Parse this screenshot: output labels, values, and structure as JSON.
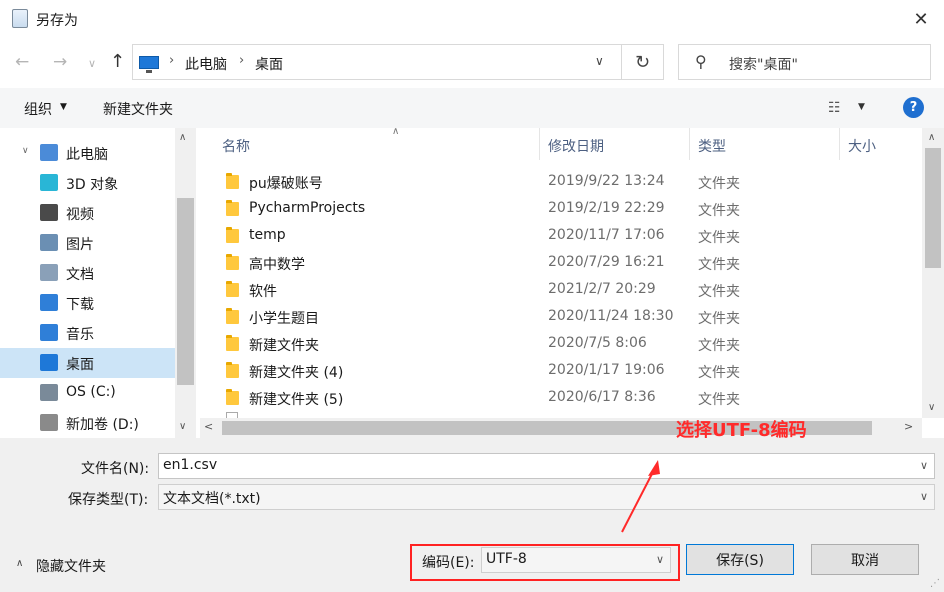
{
  "window": {
    "title": "另存为",
    "close_symbol": "✕"
  },
  "nav": {
    "back_symbol": "←",
    "forward_symbol": "→",
    "recent_symbol": "∨",
    "up_symbol": "↑",
    "breadcrumbs": [
      "此电脑",
      "桌面"
    ],
    "separator": "›",
    "dropdown_symbol": "∨",
    "refresh_symbol": "↻",
    "search_placeholder": "搜索\"桌面\"",
    "search_symbol": "⚲"
  },
  "toolbar": {
    "organize_label": "组织",
    "caret": "▼",
    "new_folder_label": "新建文件夹",
    "view_symbol": "☷",
    "help_symbol": "?"
  },
  "sidebar": {
    "items": [
      {
        "label": "此电脑",
        "icon": "pc-icon",
        "color": "#4b8bd8",
        "expand": "∨",
        "selected": false
      },
      {
        "label": "3D 对象",
        "icon": "cube-icon",
        "color": "#29b6d6",
        "expand": "",
        "selected": false
      },
      {
        "label": "视频",
        "icon": "video-icon",
        "color": "#4a4a4a",
        "expand": "",
        "selected": false
      },
      {
        "label": "图片",
        "icon": "picture-icon",
        "color": "#6b8fb3",
        "expand": "",
        "selected": false
      },
      {
        "label": "文档",
        "icon": "document-icon",
        "color": "#8aa0b8",
        "expand": "",
        "selected": false
      },
      {
        "label": "下载",
        "icon": "download-icon",
        "color": "#2f7fd8",
        "expand": "",
        "selected": false
      },
      {
        "label": "音乐",
        "icon": "music-icon",
        "color": "#2f7fd8",
        "expand": "",
        "selected": false
      },
      {
        "label": "桌面",
        "icon": "desktop-icon",
        "color": "#1e78d8",
        "expand": "",
        "selected": true
      },
      {
        "label": "OS (C:)",
        "icon": "drive-c-icon",
        "color": "#7a8a99",
        "expand": "",
        "selected": false
      },
      {
        "label": "新加卷 (D:)",
        "icon": "drive-d-icon",
        "color": "#8a8a8a",
        "expand": "",
        "selected": false
      }
    ],
    "scroll_up": "∧",
    "scroll_down": "∨"
  },
  "columns": {
    "name": "名称",
    "date": "修改日期",
    "type": "类型",
    "size": "大小",
    "sort_symbol": "∧"
  },
  "files": [
    {
      "name": "pu爆破账号",
      "date": "2019/9/22 13:24",
      "type": "文件夹"
    },
    {
      "name": "PycharmProjects",
      "date": "2019/2/19 22:29",
      "type": "文件夹"
    },
    {
      "name": "temp",
      "date": "2020/11/7 17:06",
      "type": "文件夹"
    },
    {
      "name": "高中数学",
      "date": "2020/7/29 16:21",
      "type": "文件夹"
    },
    {
      "name": "软件",
      "date": "2021/2/7 20:29",
      "type": "文件夹"
    },
    {
      "name": "小学生题目",
      "date": "2020/11/24 18:30",
      "type": "文件夹"
    },
    {
      "name": "新建文件夹",
      "date": "2020/7/5 8:06",
      "type": "文件夹"
    },
    {
      "name": "新建文件夹 (4)",
      "date": "2020/1/17 19:06",
      "type": "文件夹"
    },
    {
      "name": "新建文件夹 (5)",
      "date": "2020/6/17 8:36",
      "type": "文件夹"
    }
  ],
  "scroll": {
    "up": "∧",
    "down": "∨",
    "left": "<",
    "right": ">"
  },
  "annotation": {
    "text": "选择UTF-8编码",
    "color": "#ff2a2a"
  },
  "form": {
    "filename_label": "文件名(N):",
    "filename_value": "en1.csv",
    "filetype_label": "保存类型(T):",
    "filetype_value": "文本文档(*.txt)",
    "dropdown_symbol": "∨",
    "encoding_label": "编码(E):",
    "encoding_value": "UTF-8",
    "save_label": "保存(S)",
    "cancel_label": "取消",
    "hide_folders_label": "隐藏文件夹",
    "hide_folders_symbol": "∧",
    "grip_symbol": "⋰"
  }
}
